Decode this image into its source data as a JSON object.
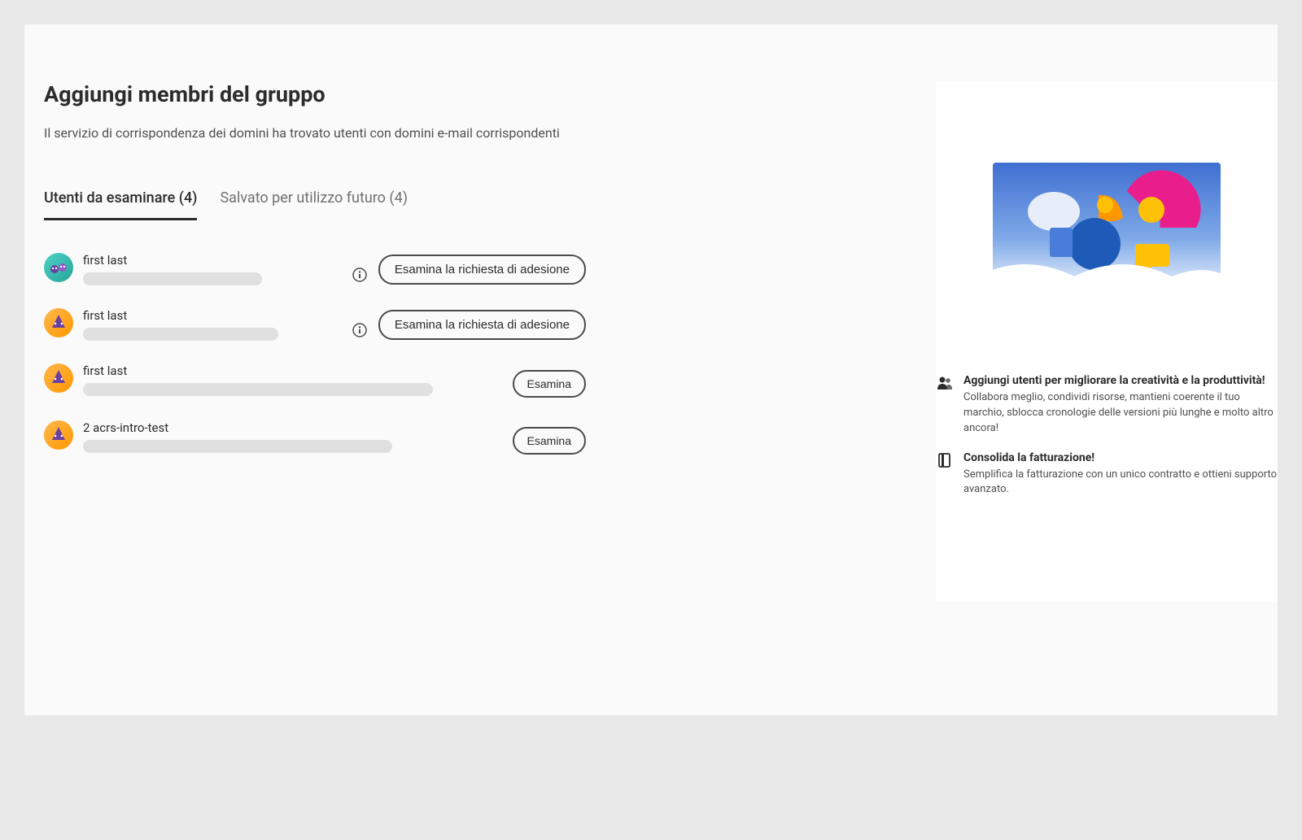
{
  "header": {
    "title": "Aggiungi membri del gruppo",
    "subtitle": "Il servizio di corrispondenza dei domini ha trovato utenti con domini e-mail corrispondenti"
  },
  "tabs": {
    "review": "Utenti da esaminare (4)",
    "saved": "Salvato per utilizzo futuro (4)"
  },
  "users": [
    {
      "name": "first last",
      "avatar": "teal",
      "action": "Esamina la richiesta di adesione",
      "info": true,
      "pw": "w1"
    },
    {
      "name": "first last",
      "avatar": "orange",
      "action": "Esamina la richiesta di adesione",
      "info": true,
      "pw": "w2"
    },
    {
      "name": "first last",
      "avatar": "orange",
      "action": "Esamina",
      "info": false,
      "pw": "w3"
    },
    {
      "name": "2 acrs-intro-test",
      "avatar": "orange",
      "action": "Esamina",
      "info": false,
      "pw": "w4"
    }
  ],
  "benefits": [
    {
      "icon": "users",
      "title": "Aggiungi utenti per migliorare la creatività e la produttività!",
      "desc": "Collabora meglio, condividi risorse, mantieni coerente il tuo marchio, sblocca cronologie delle versioni più lunghe e molto altro ancora!"
    },
    {
      "icon": "document",
      "title": "Consolida la fatturazione!",
      "desc": "Semplifica la fatturazione con un unico contratto e ottieni supporto avanzato."
    }
  ]
}
